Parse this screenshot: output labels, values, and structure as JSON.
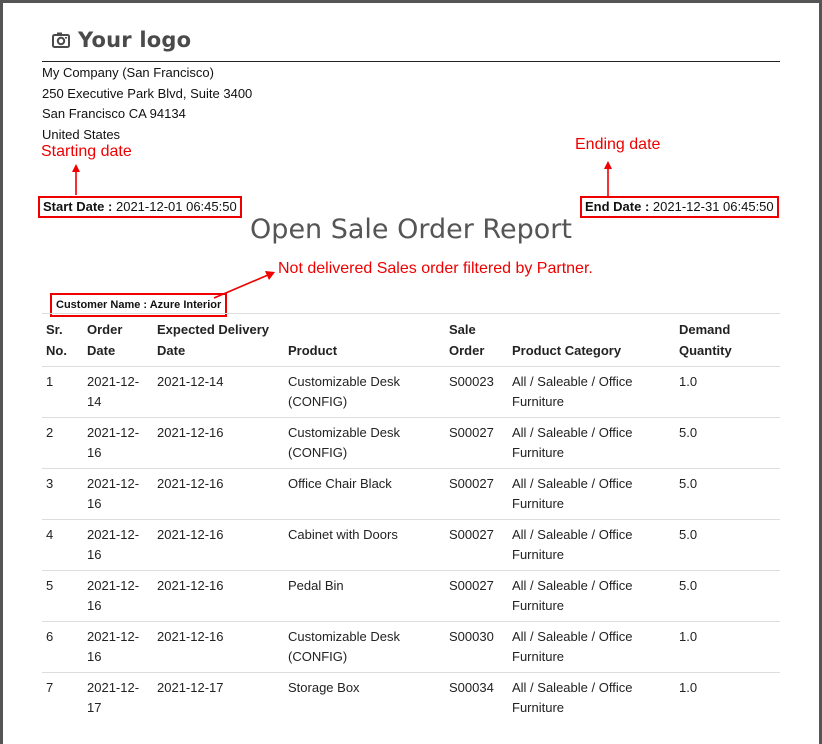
{
  "logo": {
    "text": "Your logo",
    "icon": "camera-icon"
  },
  "company": {
    "name": "My Company (San Francisco)",
    "street": "250 Executive Park Blvd, Suite 3400",
    "city": "San Francisco CA 94134",
    "country": "United States"
  },
  "annotations": {
    "starting": "Starting date",
    "ending": "Ending date",
    "partner": "Not delivered Sales order filtered by Partner.",
    "color": "#e00000"
  },
  "dates": {
    "start_label": "Start Date :",
    "start_value": "2021-12-01 06:45:50",
    "end_label": "End Date :",
    "end_value": "2021-12-31 06:45:50"
  },
  "report_title": "Open Sale Order Report",
  "customer": {
    "label": "Customer Name :",
    "value": "Azure Interior"
  },
  "table": {
    "headers": {
      "sr_line1": "Sr.",
      "sr_line2": "No.",
      "od_line1": "Order",
      "od_line2": "Date",
      "ed_line1": "Expected Delivery",
      "ed_line2": "Date",
      "product": "Product",
      "so_line1": "Sale",
      "so_line2": "Order",
      "category": "Product Category",
      "dq_line1": "Demand",
      "dq_line2": "Quantity"
    },
    "rows": [
      {
        "sr": "1",
        "od_a": "2021-12-",
        "od_b": "14",
        "expected": "2021-12-14",
        "prod_a": "Customizable Desk",
        "prod_b": "(CONFIG)",
        "so": "S00023",
        "cat_a": "All / Saleable / Office",
        "cat_b": "Furniture",
        "qty": "1.0"
      },
      {
        "sr": "2",
        "od_a": "2021-12-",
        "od_b": "16",
        "expected": "2021-12-16",
        "prod_a": "Customizable Desk",
        "prod_b": "(CONFIG)",
        "so": "S00027",
        "cat_a": "All / Saleable / Office",
        "cat_b": "Furniture",
        "qty": "5.0"
      },
      {
        "sr": "3",
        "od_a": "2021-12-",
        "od_b": "16",
        "expected": "2021-12-16",
        "prod_a": "Office Chair Black",
        "prod_b": "",
        "so": "S00027",
        "cat_a": "All / Saleable / Office",
        "cat_b": "Furniture",
        "qty": "5.0"
      },
      {
        "sr": "4",
        "od_a": "2021-12-",
        "od_b": "16",
        "expected": "2021-12-16",
        "prod_a": "Cabinet with Doors",
        "prod_b": "",
        "so": "S00027",
        "cat_a": "All / Saleable / Office",
        "cat_b": "Furniture",
        "qty": "5.0"
      },
      {
        "sr": "5",
        "od_a": "2021-12-",
        "od_b": "16",
        "expected": "2021-12-16",
        "prod_a": "Pedal Bin",
        "prod_b": "",
        "so": "S00027",
        "cat_a": "All / Saleable / Office",
        "cat_b": "Furniture",
        "qty": "5.0"
      },
      {
        "sr": "6",
        "od_a": "2021-12-",
        "od_b": "16",
        "expected": "2021-12-16",
        "prod_a": "Customizable Desk",
        "prod_b": "(CONFIG)",
        "so": "S00030",
        "cat_a": "All / Saleable / Office",
        "cat_b": "Furniture",
        "qty": "1.0"
      },
      {
        "sr": "7",
        "od_a": "2021-12-",
        "od_b": "17",
        "expected": "2021-12-17",
        "prod_a": "Storage Box",
        "prod_b": "",
        "so": "S00034",
        "cat_a": "All / Saleable / Office",
        "cat_b": "Furniture",
        "qty": "1.0"
      }
    ]
  }
}
